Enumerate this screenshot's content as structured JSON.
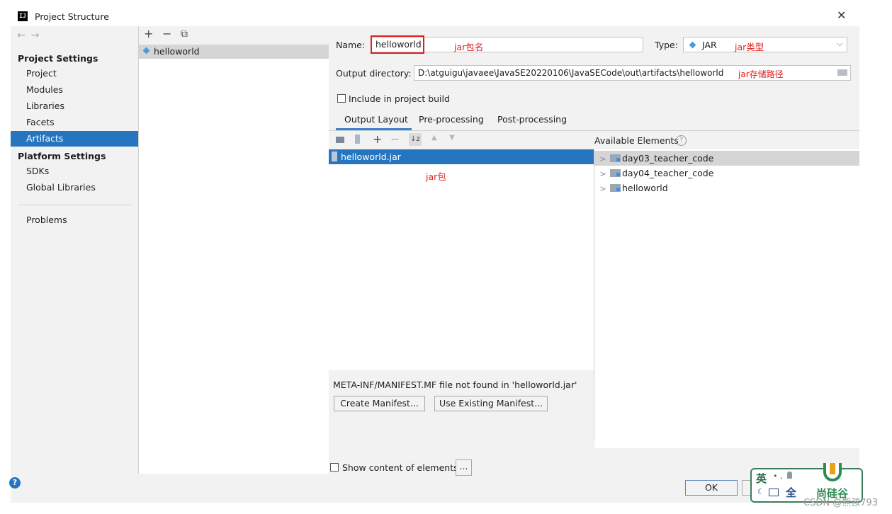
{
  "window": {
    "title": "Project Structure",
    "app_icon": "IJ",
    "close_label": "✕"
  },
  "nav": {
    "back": "←",
    "forward": "→",
    "project_settings": "Project Settings",
    "ps_items": [
      "Project",
      "Modules",
      "Libraries",
      "Facets",
      "Artifacts"
    ],
    "platform_settings": "Platform Settings",
    "pl_items": [
      "SDKs",
      "Global Libraries"
    ],
    "problems": "Problems",
    "selected": "Artifacts"
  },
  "artifacts": {
    "add": "+",
    "remove": "−",
    "copy": "⧉",
    "items": [
      "helloworld"
    ]
  },
  "detail": {
    "name_label": "Name:",
    "name_value": "helloworld",
    "name_note": "jar包名",
    "type_label": "Type:",
    "type_value": "JAR",
    "type_note": "jar类型",
    "output_label": "Output directory:",
    "output_value": "D:\\atguigu\\javaee\\JavaSE20220106\\JavaSECode\\out\\artifacts\\helloworld",
    "output_note": "jar存储路径",
    "include_label": "Include in project build",
    "tabs": [
      "Output Layout",
      "Pre-processing",
      "Post-processing"
    ],
    "active_tab": "Output Layout"
  },
  "layout": {
    "jar_item": "helloworld.jar",
    "jar_note": "jar包",
    "manifest_msg": "META-INF/MANIFEST.MF file not found in 'helloworld.jar'",
    "create_manifest": "Create Manifest...",
    "use_existing_manifest": "Use Existing Manifest...",
    "show_content": "Show content of elements",
    "more": "..."
  },
  "available": {
    "header": "Available Elements",
    "help": "?",
    "items": [
      "day03_teacher_code",
      "day04_teacher_code",
      "helloworld"
    ]
  },
  "footer": {
    "ok": "OK",
    "help": "?"
  },
  "overlay": {
    "ime_glyph_1": "英",
    "ime_glyph_2": "全",
    "logo_text": "尚硅谷",
    "watermark": "CSDN @熊孩793"
  },
  "colors": {
    "selection": "#2675bf",
    "annotation": "#e02020",
    "tab_underline": "#4083c9"
  }
}
